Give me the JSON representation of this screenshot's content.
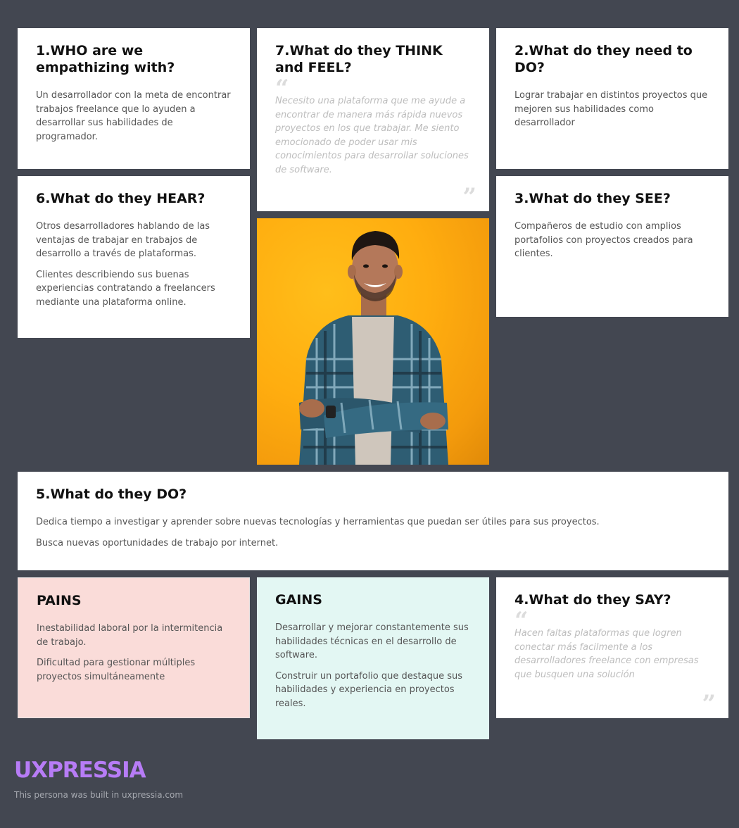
{
  "who": {
    "title": "1.WHO are we empathizing with?",
    "text": "Un desarrollador con la meta de encontrar trabajos freelance que lo ayuden a desarrollar sus habilidades de programador."
  },
  "think": {
    "title": "7.What do they THINK and FEEL?",
    "open_quote": "“",
    "quote": "Necesito una plataforma que me ayude a encontrar de manera más rápida nuevos proyectos en los que trabajar.  Me siento emocionado de poder usar mis conocimientos para desarrollar soluciones de software.",
    "close_quote": "”"
  },
  "need": {
    "title": "2.What do they need to DO?",
    "text": "Lograr trabajar en distintos proyectos que mejoren sus habilidades como desarrollador"
  },
  "hear": {
    "title": "6.What do they HEAR?",
    "items": [
      "Otros desarrolladores hablando de las ventajas de trabajar en trabajos de desarrollo a través de plataformas.",
      "Clientes describiendo sus buenas experiencias contratando a freelancers mediante una plataforma online."
    ]
  },
  "see": {
    "title": "3.What do they SEE?",
    "text": "Compañeros de estudio con amplios portafolios con proyectos creados para clientes."
  },
  "do": {
    "title": "5.What do they DO?",
    "items": [
      "Dedica tiempo a investigar y aprender sobre nuevas tecnologías y herramientas que puedan ser útiles para sus proyectos.",
      "Busca nuevas oportunidades de trabajo por internet."
    ]
  },
  "pains": {
    "title": "PAINS",
    "items": [
      "Inestabilidad laboral por la intermitencia de trabajo.",
      "Dificultad para gestionar múltiples proyectos simultáneamente"
    ]
  },
  "gains": {
    "title": "GAINS",
    "items": [
      "Desarrollar y mejorar constantemente sus habilidades técnicas en el desarrollo de software.",
      "Construir un portafolio que destaque sus habilidades y experiencia en proyectos reales."
    ]
  },
  "say": {
    "title": "4.What do they SAY?",
    "open_quote": "“",
    "quote": "Hacen faltas plataformas que logren conectar más facilmente a los desarrolladores freelance con empresas que busquen una solución",
    "close_quote": "”"
  },
  "brand": {
    "logo": "UXPRESSIA",
    "footer": "This persona was built in uxpressia.com"
  },
  "colors": {
    "background": "#434751",
    "pains": "#fadcd9",
    "gains": "#e3f7f3",
    "brand": "#b77cf6",
    "photo_background": "#ffad0f"
  }
}
